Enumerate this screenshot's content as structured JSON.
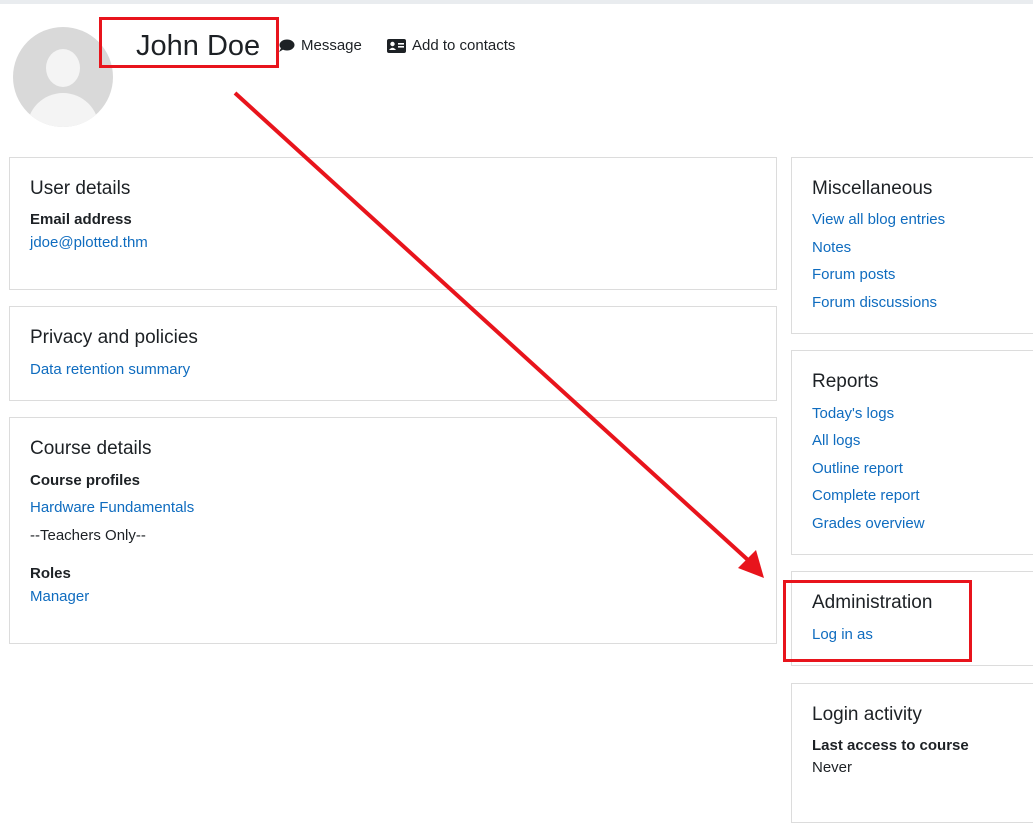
{
  "profile": {
    "name": "John Doe",
    "message_label": "Message",
    "add_contact_label": "Add to contacts"
  },
  "user_details": {
    "title": "User details",
    "email_label": "Email address",
    "email_value": "jdoe@plotted.thm"
  },
  "privacy": {
    "title": "Privacy and policies",
    "link": "Data retention summary"
  },
  "course": {
    "title": "Course details",
    "profiles_label": "Course profiles",
    "course_link": "Hardware Fundamentals",
    "group_text": "--Teachers Only--",
    "roles_label": "Roles",
    "role_link": "Manager"
  },
  "misc": {
    "title": "Miscellaneous",
    "links": [
      "View all blog entries",
      "Notes",
      "Forum posts",
      "Forum discussions"
    ]
  },
  "reports": {
    "title": "Reports",
    "links": [
      "Today's logs",
      "All logs",
      "Outline report",
      "Complete report",
      "Grades overview"
    ]
  },
  "admin": {
    "title": "Administration",
    "link": "Log in as"
  },
  "login_activity": {
    "title": "Login activity",
    "last_access_label": "Last access to course",
    "last_access_value": "Never"
  },
  "colors": {
    "link": "#0f6cbf",
    "highlight": "#e8141c"
  }
}
